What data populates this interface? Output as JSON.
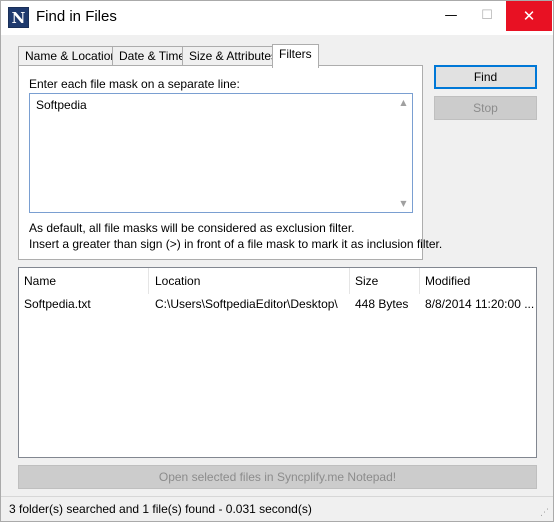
{
  "window": {
    "title": "Find in Files",
    "app_icon_letter": "N",
    "minimize_glyph": "—",
    "maximize_glyph": "☐",
    "close_glyph": "✕"
  },
  "tabs": [
    {
      "label": "Name & Location",
      "active": false
    },
    {
      "label": "Date & Time",
      "active": false
    },
    {
      "label": "Size & Attributes",
      "active": false
    },
    {
      "label": "Filters",
      "active": true
    }
  ],
  "filters": {
    "prompt": "Enter each file mask on a separate line:",
    "mask_text": "Softpedia",
    "note_line1": "As default, all file masks will be considered as exclusion filter.",
    "note_line2": "Insert a greater than sign (>) in front of a file mask to mark it as inclusion filter."
  },
  "buttons": {
    "find": "Find",
    "stop": "Stop",
    "open_selected": "Open selected files in Syncplify.me Notepad!"
  },
  "results": {
    "columns": [
      "Name",
      "Location",
      "Size",
      "Modified"
    ],
    "rows": [
      {
        "name": "Softpedia.txt",
        "location": "C:\\Users\\SoftpediaEditor\\Desktop\\",
        "size": "448 Bytes",
        "modified": "8/8/2014 11:20:00 ..."
      }
    ]
  },
  "status": {
    "text": "3 folder(s) searched and 1 file(s) found - 0.031 second(s)"
  },
  "colors": {
    "close_button": "#e81123",
    "focus_border": "#0078d7"
  }
}
